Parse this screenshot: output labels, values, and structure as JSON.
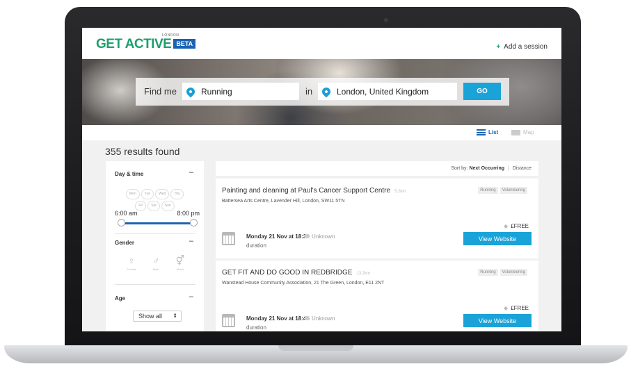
{
  "header": {
    "logo_small": "LONDON",
    "logo_main": "GET ACTIVE",
    "logo_beta": "BETA",
    "add_session": "Add a session"
  },
  "search": {
    "find_label": "Find me",
    "activity": "Running",
    "in_label": "in",
    "location": "London, United Kingdom",
    "go_label": "GO"
  },
  "view": {
    "list_label": "List",
    "map_label": "Map"
  },
  "results": {
    "count_text": "355 results found"
  },
  "filters": {
    "day_time_label": "Day & time",
    "days": [
      "Mon",
      "Tue",
      "Wed",
      "Thu",
      "Fri",
      "Sat",
      "Sun"
    ],
    "time_from": "6:00 am",
    "time_to": "8:00 pm",
    "gender_label": "Gender",
    "gender_options": [
      "Female",
      "Male",
      "Mixed"
    ],
    "age_label": "Age",
    "age_value": "Show all",
    "collapse_symbol": "–"
  },
  "sort": {
    "label": "Sort by:",
    "active": "Next Occurring",
    "separator": "|",
    "other": "Distance"
  },
  "cards": [
    {
      "title": "Painting and cleaning at Paul's Cancer Support Centre",
      "distance": "5.2km",
      "tags": [
        "Running",
        "Volunteering"
      ],
      "address": "Battersea Arts Centre, Lavender Hill, London, SW11 5TN",
      "price": "£FREE",
      "date": "Monday 21 Nov at 18:30",
      "unknown": "Unknown",
      "duration": "duration",
      "button": "View Website"
    },
    {
      "title": "GET FIT AND DO GOOD IN REDBRIDGE",
      "distance": "13.2km",
      "tags": [
        "Running",
        "Volunteering"
      ],
      "address": "Wanstead House Community Association, 21 The Green, London, E11 2NT",
      "price": "£FREE",
      "date": "Monday 21 Nov at 18:45",
      "unknown": "Unknown",
      "duration": "duration",
      "button": "View Website"
    }
  ],
  "colors": {
    "brand_green": "#1c9f6f",
    "accent_blue": "#1aa3d9",
    "beta_blue": "#1a63b3"
  }
}
